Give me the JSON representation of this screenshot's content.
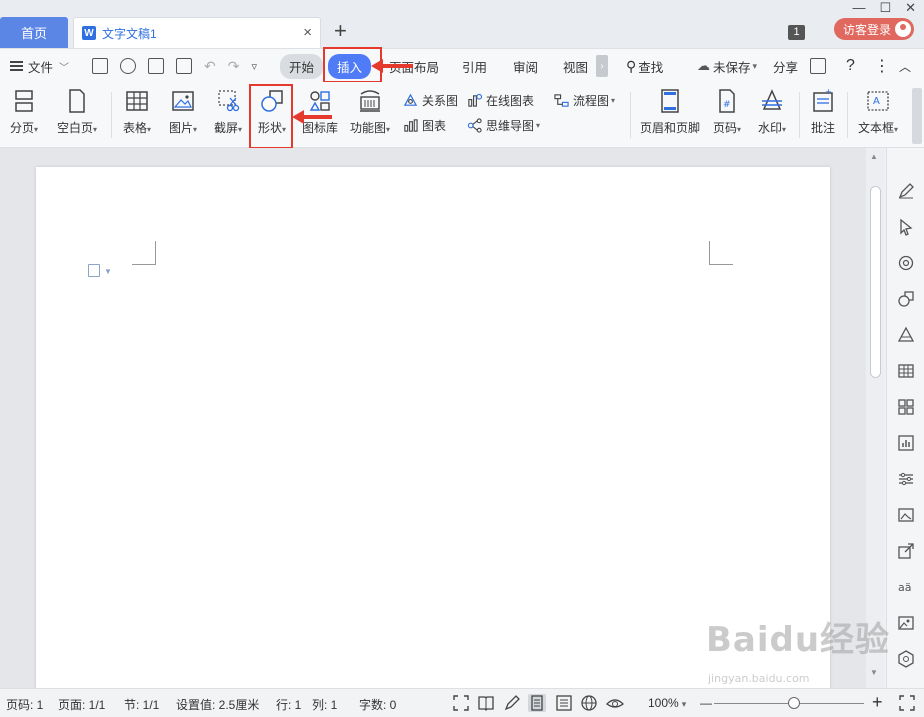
{
  "tabs": {
    "home_label": "首页",
    "doc_label": "文字文稿1",
    "doc_icon": "W",
    "close_glyph": "×",
    "add_glyph": "+"
  },
  "window": {
    "badge": "1",
    "login_label": "访客登录",
    "minimize": "—",
    "maximize": "☐",
    "close": "✕"
  },
  "menu": {
    "file_label": "文件",
    "start": "开始",
    "insert": "插入",
    "page_layout": "页面布局",
    "reference": "引用",
    "review": "审阅",
    "view": "视图",
    "more_chev": "›",
    "search": "查找",
    "unsaved": "未保存",
    "share": "分享",
    "help": "?",
    "more": "⋮",
    "collapse": "︿"
  },
  "ribbon": {
    "page_break": "分页",
    "blank_page": "空白页",
    "table": "表格",
    "picture": "图片",
    "screenshot": "截屏",
    "shape": "形状",
    "icon_lib": "图标库",
    "func_chart": "功能图",
    "relation_chart": "关系图",
    "online_chart": "在线图表",
    "flowchart": "流程图",
    "chart": "图表",
    "mindmap": "思维导图",
    "header_footer": "页眉和页脚",
    "page_num": "页码",
    "watermark": "水印",
    "comment": "批注",
    "textbox": "文本框",
    "dropdown": "▾"
  },
  "status": {
    "page_num": "页码: 1",
    "pages": "页面: 1/1",
    "section": "节: 1/1",
    "setting": "设置值: 2.5厘米",
    "row": "行: 1",
    "col": "列: 1",
    "word_count": "字数: 0",
    "zoom": "100%",
    "zoom_minus": "—",
    "zoom_plus": "+",
    "zoom_level": 0.53
  },
  "watermark": {
    "text": "Baidu经验",
    "sub": "jingyan.baidu.com"
  },
  "colors": {
    "accent": "#4f7cf6",
    "highlight": "#e5392e",
    "home_tab": "#5b86e5",
    "login": "#e0685f"
  }
}
